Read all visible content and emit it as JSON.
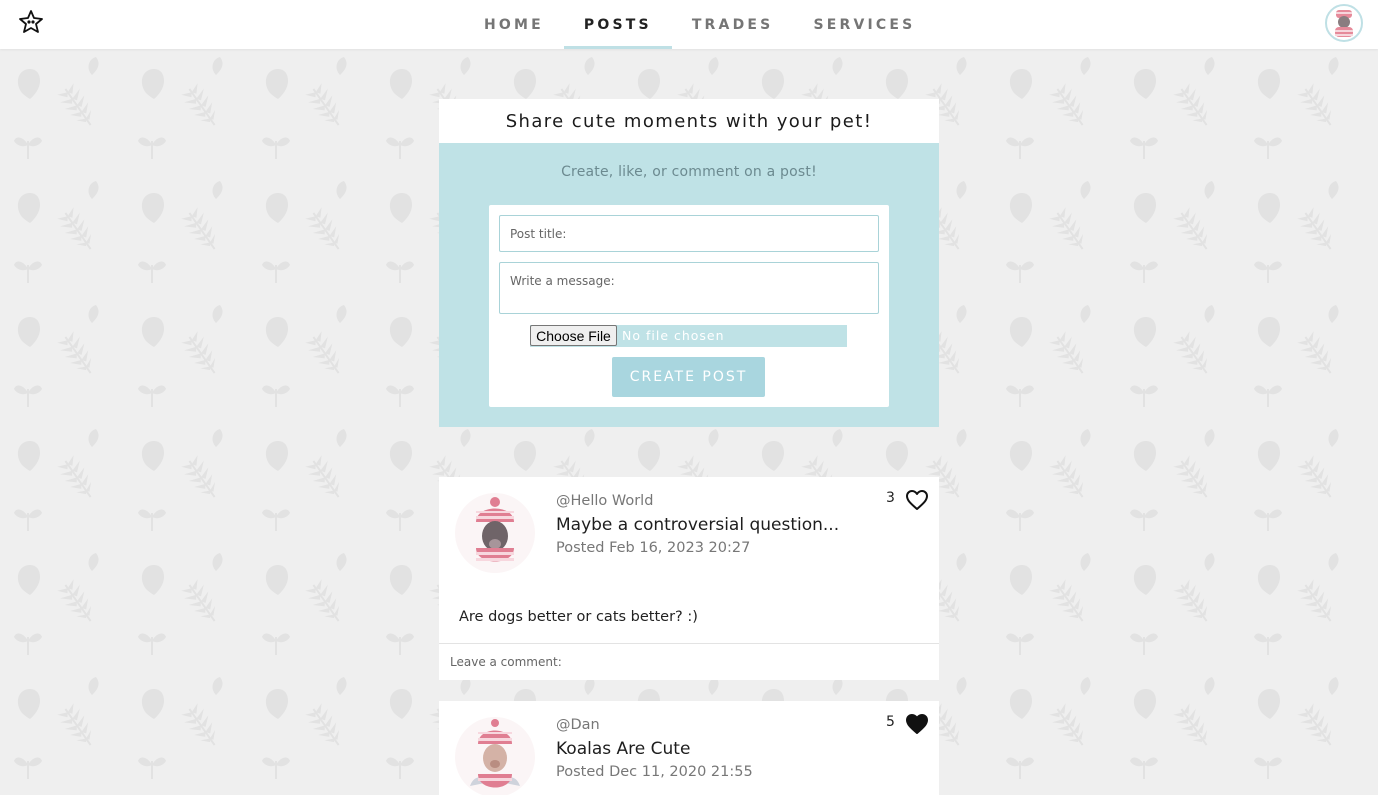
{
  "nav": {
    "items": [
      {
        "label": "HOME",
        "active": false
      },
      {
        "label": "POSTS",
        "active": true
      },
      {
        "label": "TRADES",
        "active": false
      },
      {
        "label": "SERVICES",
        "active": false
      }
    ],
    "logo_icon": "paw-star-icon",
    "avatar_icon": "user-avatar"
  },
  "create": {
    "heading": "Share cute moments with your pet!",
    "subheading": "Create, like, or comment on a post!",
    "title_placeholder": "Post title:",
    "message_placeholder": "Write a message:",
    "file_button": "Choose File",
    "file_status": "No file chosen",
    "submit_label": "CREATE POST"
  },
  "posts": [
    {
      "user": "@Hello World",
      "title": "Maybe a controversial question...",
      "date": "Posted Feb 16, 2023 20:27",
      "likes": "3",
      "liked": false,
      "body": "Are dogs better or cats better? :)",
      "comment_placeholder": "Leave a comment:"
    },
    {
      "user": "@Dan",
      "title": "Koalas Are Cute",
      "date": "Posted Dec 11, 2020 21:55",
      "likes": "5",
      "liked": true
    }
  ],
  "colors": {
    "accent": "#bfe2e6",
    "button": "#a9d6df",
    "background": "#efefef"
  }
}
